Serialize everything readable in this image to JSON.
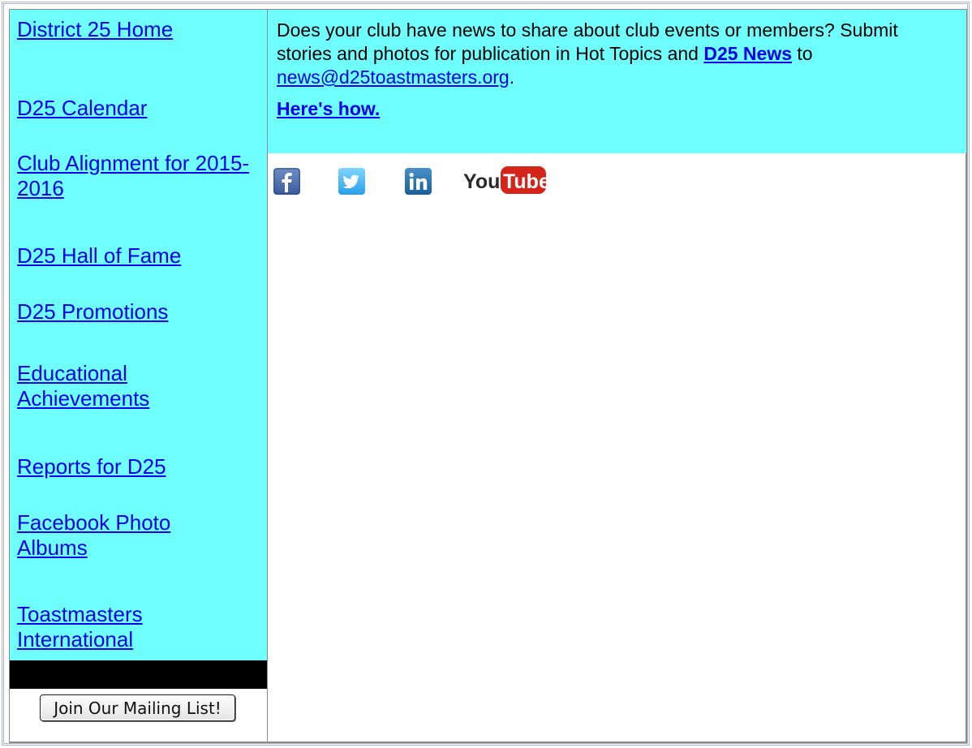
{
  "sidebar": {
    "items": [
      {
        "label": "District 25 Home"
      },
      {
        "label": "D25 Calendar"
      },
      {
        "label": "Club Alignment for 2015-2016"
      },
      {
        "label": "D25 Hall of Fame"
      },
      {
        "label": "D25 Promotions"
      },
      {
        "label": "Educational Achievements"
      },
      {
        "label": "Reports for D25"
      },
      {
        "label": "Facebook Photo Albums"
      },
      {
        "label": "Toastmasters International"
      }
    ],
    "mailing_button": "Join Our Mailing List!"
  },
  "news": {
    "text_before": "Does your club have news to share about club events or members? Submit stories and photos for publication in Hot Topics and ",
    "news_link": "D25 News",
    "text_middle": " to ",
    "email_link": "news@d25toastmasters.org",
    "text_after": ".",
    "howto_link": "Here's how."
  },
  "social": {
    "icons": [
      "facebook-icon",
      "twitter-icon",
      "linkedin-icon",
      "youtube-icon"
    ],
    "youtube_you": "You",
    "youtube_tube": "Tube"
  },
  "colors": {
    "panel_bg": "#6ffffe",
    "link": "#0000ee"
  }
}
